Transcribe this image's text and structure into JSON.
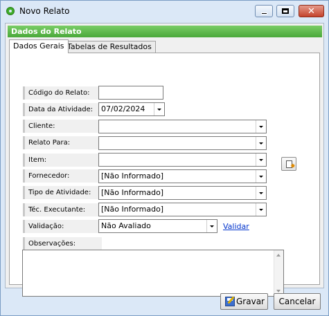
{
  "window": {
    "title": "Novo Relato",
    "icon": "app-green-circle-icon"
  },
  "section": {
    "title": "Dados do Relato"
  },
  "tabs": [
    {
      "label": "Dados Gerais",
      "active": true
    },
    {
      "label": "Tabelas de Resultados",
      "active": false
    }
  ],
  "form": {
    "codigo": {
      "label": "Código do Relato:",
      "value": ""
    },
    "data": {
      "label": "Data da Atividade:",
      "value": "07/02/2024"
    },
    "cliente": {
      "label": "Cliente:",
      "value": ""
    },
    "relato_para": {
      "label": "Relato Para:",
      "value": ""
    },
    "item": {
      "label": "Item:",
      "value": ""
    },
    "fornecedor": {
      "label": "Fornecedor:",
      "value": "[Não Informado]"
    },
    "tipo": {
      "label": "Tipo de Atividade:",
      "value": "[Não Informado]"
    },
    "tecnico": {
      "label": "Téc. Executante:",
      "value": "[Não Informado]"
    },
    "validacao": {
      "label": "Validação:",
      "value": "Não Avaliado",
      "link": "Validar"
    },
    "observacoes": {
      "label": "Observações:",
      "value": ""
    }
  },
  "buttons": {
    "save": "Gravar",
    "cancel": "Cancelar"
  },
  "colors": {
    "header_green": "#4aa83a",
    "link_blue": "#0033cc"
  }
}
